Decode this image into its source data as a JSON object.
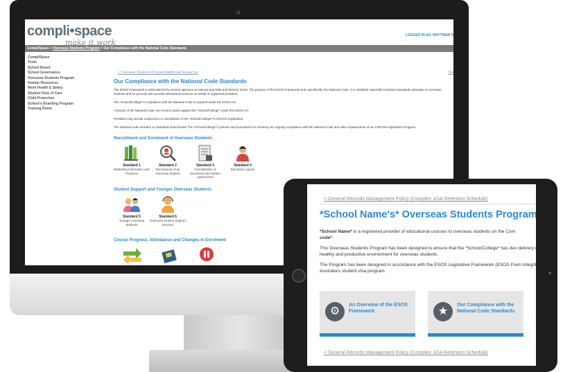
{
  "desktop": {
    "logo_text": "compli•space",
    "logo_tagline": "make it work",
    "logged_in": "LOGGED IN AS: MATTHEW S",
    "breadcrumb": {
      "root": "CompliSpace",
      "sep1": " > ",
      "section": "Overseas Students Program",
      "sep2": " > ",
      "current": "Our Compliance with the National Code Standards"
    },
    "nav": [
      "CompliSpace",
      "Tools",
      "School Board",
      "School Governance",
      "Overseas Students Program",
      "Human Resources",
      "Work Health & Safety",
      "Student Duty of Care",
      "Child Protection",
      "School's Boarding Program",
      "Training Room"
    ],
    "prev_link": "< Overseas Students Program Additional Resources",
    "next_link": "Sta",
    "title": "Our Compliance with the National Code Standards",
    "paragraphs": [
      "The ESOS Framework is administered by several agencies at national and state and territory levels. The purpose of the ESOS Framework and, specifically, the National Code, is to establish nationally consistent standards education to overseas students and for persons who provide educational services on behalf of registered providers.",
      "The *School/College*'s compliance with the National Code is required under the ESOS Act.",
      "A breach of the National Code can result in action against the *School/College* under the ESOS Act.",
      "Penalties may include suspension or cancellation of the *School/College*'s CRICOS registration.",
      "The National Code includes 11 standards listed below. The *School/College*'s policies and procedures for ensuring our ongoing compliance with the National Code and other requirements of our CRICOS registration Program:"
    ],
    "section_recruitment": "Recruitment and Enrolment of Overseas Students",
    "section_support": "Student Support and Younger Overseas Students",
    "section_progress": "Course Progress, Attendance and Changes in Enrolment",
    "standards": [
      {
        "title": "Standard 1",
        "desc": "Marketing Information and Practices",
        "icon": "books-icon"
      },
      {
        "title": "Standard 2",
        "desc": "Recruitment of an Overseas Student",
        "icon": "magnifier-person-icon"
      },
      {
        "title": "Standard 3",
        "desc": "Formalisation of Enrolment and Written Agreements",
        "icon": "document-form-icon"
      },
      {
        "title": "Standard 4",
        "desc": "Education Agents",
        "icon": "agent-person-icon"
      },
      {
        "title": "Standard 5",
        "desc": "Younger Overseas Students",
        "icon": "students-icon"
      },
      {
        "title": "Standard 6",
        "desc": "Overseas Student Support Services",
        "icon": "support-headset-icon"
      }
    ]
  },
  "tablet": {
    "prev_link": "< General Records Management Policy (Complex: ASA Retention Schedule)",
    "title": "*School Name's* Overseas Students Program",
    "para1_start": "*School Name*",
    "para1_rest": " is a registered provider of educational courses to overseas students on the Com",
    "para1_bold2": "code*",
    "para2": "This Overseas Students Program has been designed to ensure that the *School/College* has dev delivery of a safe, healthy and productive environment for overseas students.",
    "para3": "The Program has been designed in accordance with the ESOS Legislative Framework (ESOS Fram integrity of Australia's student visa program.",
    "card1": "An Overview of the ESOS Framework",
    "card2": "Our Compliance with the National Code Standards",
    "bottom_link": "< General Records Management Policy (Complex: ASA Retention Schedule)"
  },
  "colors": {
    "accent_blue": "#2b86c5",
    "breadcrumb_bar": "#7b7b7b",
    "device_frame": "#1c1c1c"
  }
}
